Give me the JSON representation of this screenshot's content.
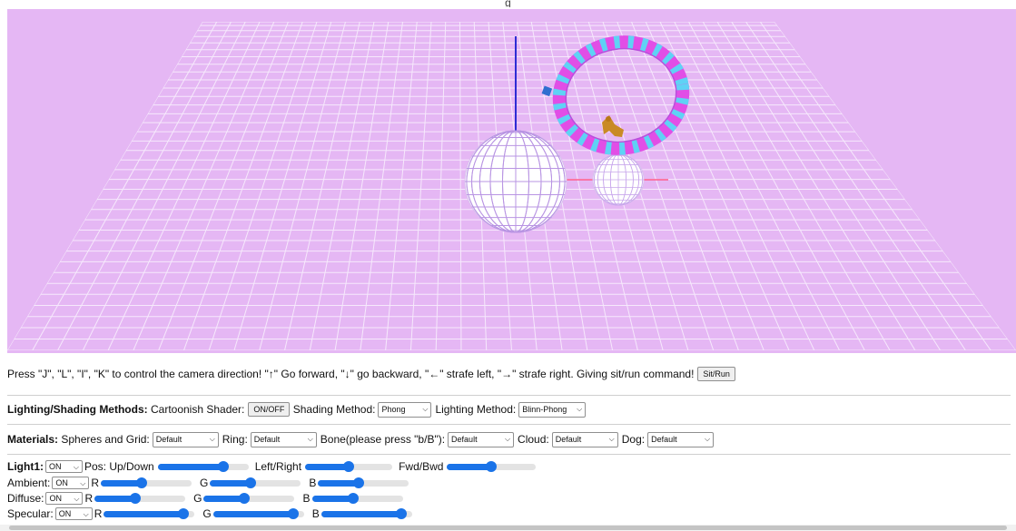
{
  "fragment_title": "g",
  "controls_line": {
    "text": "Press \"J\", \"L\", \"I\", \"K\" to control the camera direction!  \"↑\"  Go forward,  \"↓\"  go backward,  \"←\"  strafe left,  \"→\"  strafe right. Giving sit/run command!",
    "button": "Sit/Run"
  },
  "lighting": {
    "heading": "Lighting/Shading Methods:",
    "cartoon_label": "Cartoonish Shader:",
    "cartoon_button": "ON/OFF",
    "shading_label": "Shading Method:",
    "shading_value": "Phong",
    "lighting_label": "Lighting Method:",
    "lighting_value": "Blinn-Phong"
  },
  "materials": {
    "heading": "Materials:",
    "spheres_label": "Spheres and Grid:",
    "spheres_value": "Default",
    "ring_label": "Ring:",
    "ring_value": "Default",
    "bone_label": "Bone(please press \"b/B\"):",
    "bone_value": "Default",
    "cloud_label": "Cloud:",
    "cloud_value": "Default",
    "dog_label": "Dog:",
    "dog_value": "Default"
  },
  "light1": {
    "heading": "Light1:",
    "state": "ON",
    "pos_label": "Pos: Up/Down",
    "leftright_label": "Left/Right",
    "fwdbwd_label": "Fwd/Bwd",
    "pos_updown_level": 0.72,
    "pos_leftright_level": 0.5,
    "pos_fwdbwd_level": 0.5,
    "ambient_label": "Ambient:",
    "ambient_state": "ON",
    "ambient_rgb": [
      0.45,
      0.45,
      0.45
    ],
    "diffuse_label": "Diffuse:",
    "diffuse_state": "ON",
    "diffuse_rgb": [
      0.45,
      0.45,
      0.45
    ],
    "specular_label": "Specular:",
    "specular_state": "ON",
    "specular_rgb": [
      0.88,
      0.88,
      0.88
    ],
    "r": "R",
    "g": "G",
    "b": "B"
  },
  "colors": {
    "canvas_bg": "#e5b7f4",
    "grid_line": "#f6e9fc",
    "accent": "#1a73e8",
    "ring_pink": "#e14ee6",
    "ring_cyan": "#5fd2f5",
    "axis_blue": "#2d2dd4",
    "axis_red": "#ff5a8a",
    "dog": "#c98a25"
  },
  "icons": {
    "dropdown": "chevron-down-icon"
  }
}
